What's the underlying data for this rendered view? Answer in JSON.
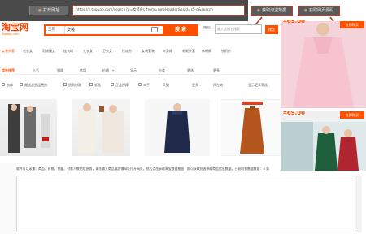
{
  "toolbar": {
    "open_label": "打开网址",
    "url": "https://s.taobao.com/search?q=女装&s_from=newHeader&ssid=s5-e&search",
    "fetch_data_label": "获取淘宝数据",
    "fetch_code_label": "获取网页源码"
  },
  "taobao": {
    "logo": "淘宝网",
    "logo_sub": "Taobao.com",
    "search_category": "宝贝",
    "search_query": "女装",
    "search_button": "搜 索",
    "shop_radio": "搜店",
    "shop_placeholder": "输入店铺名搜索",
    "shop_button": "搜店"
  },
  "keywords": [
    "女装外套",
    "毛衣女",
    "羽绒服女",
    "连衣裙",
    "大衣女",
    "卫衣女",
    "打底衫",
    "女装套装",
    "半身裙",
    "毛呢外套",
    "休闲裤",
    "针织衫"
  ],
  "nav_tabs": [
    "综合排序",
    "人气",
    "销量",
    "信用",
    "价格",
    "显示",
    "分类",
    "筛选",
    "更多"
  ],
  "filters": [
    "包邮",
    "赠送退货运费险",
    "货到付款",
    "新品",
    "正品保障",
    "二手",
    "天猫",
    "更多",
    "所在地",
    "显示更多筛选"
  ],
  "promo": {
    "price_1": "¥69.00",
    "tag_1": "立即购买",
    "price_2": "¥69.00",
    "tag_2": "立即购买"
  },
  "status": {
    "text": "软件可以采集：商品、价格、销量、付款人数的信息等，请先输入商品或店铺网址打开网页，然后点击获取淘宝数据按钮，即可获取到选择的商品信息数据，已获取到数据数量：0 条"
  },
  "colors": {
    "accent": "#ff5000",
    "toolbar_bg": "#4a4a4a",
    "highlight_border": "#c0392b"
  }
}
